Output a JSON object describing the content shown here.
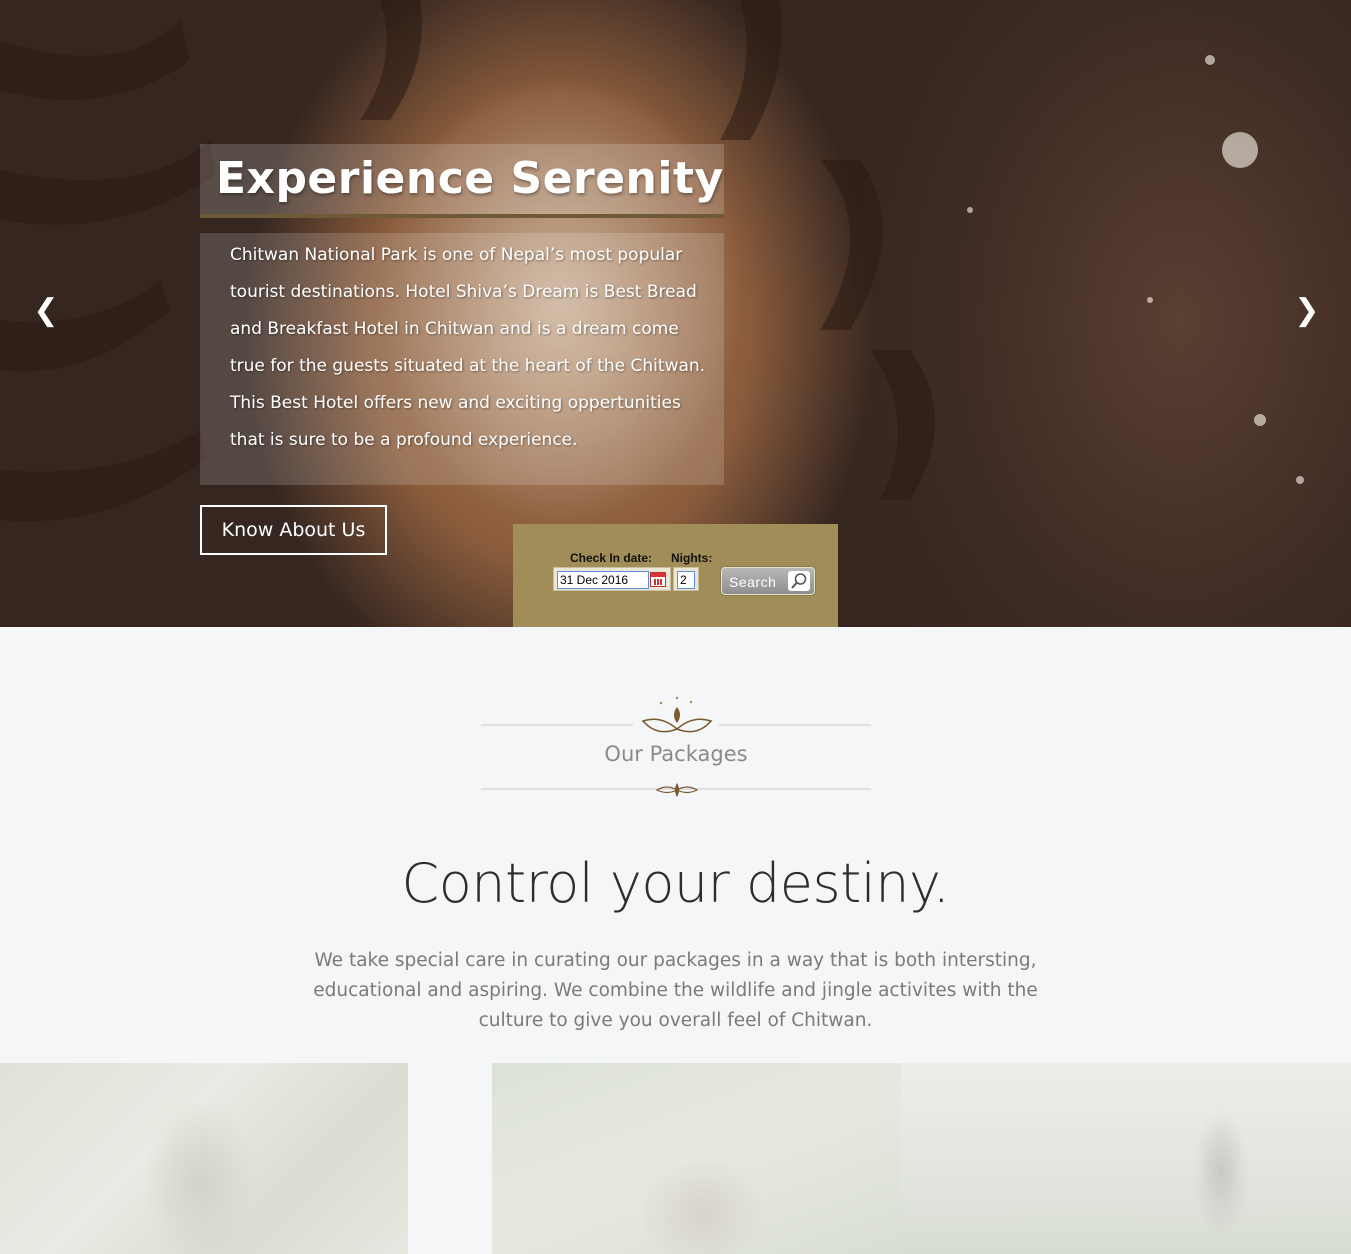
{
  "hero": {
    "title": "Experience Serenity",
    "description": "Chitwan National Park is one of Nepal’s most popular tourist destinations. Hotel Shiva’s Dream is Best Bread and Breakfast Hotel in Chitwan and is a dream come true for the guests situated at the heart of the Chitwan. This Best Hotel offers new and exciting oppertunities that is sure to be a profound experience.",
    "cta_label": "Know About Us",
    "prev_icon": "chevron-left-icon",
    "next_icon": "chevron-right-icon"
  },
  "booking": {
    "checkin_label": "Check In date:",
    "checkin_value": "31 Dec 2016",
    "nights_label": "Nights:",
    "nights_value": "2",
    "search_label": "Search",
    "panel_color": "#a08d57"
  },
  "packages": {
    "section_title": "Our Packages",
    "headline": "Control your destiny.",
    "lead": "We take special care in curating our packages in a way that is both intersting, educational and aspiring. We combine the wildlife and jingle activites with the culture to give you overall feel of Chitwan."
  },
  "colors": {
    "accent": "#a08d57",
    "ornament": "#7a5a2e",
    "page_bg": "#f5f6f7"
  }
}
